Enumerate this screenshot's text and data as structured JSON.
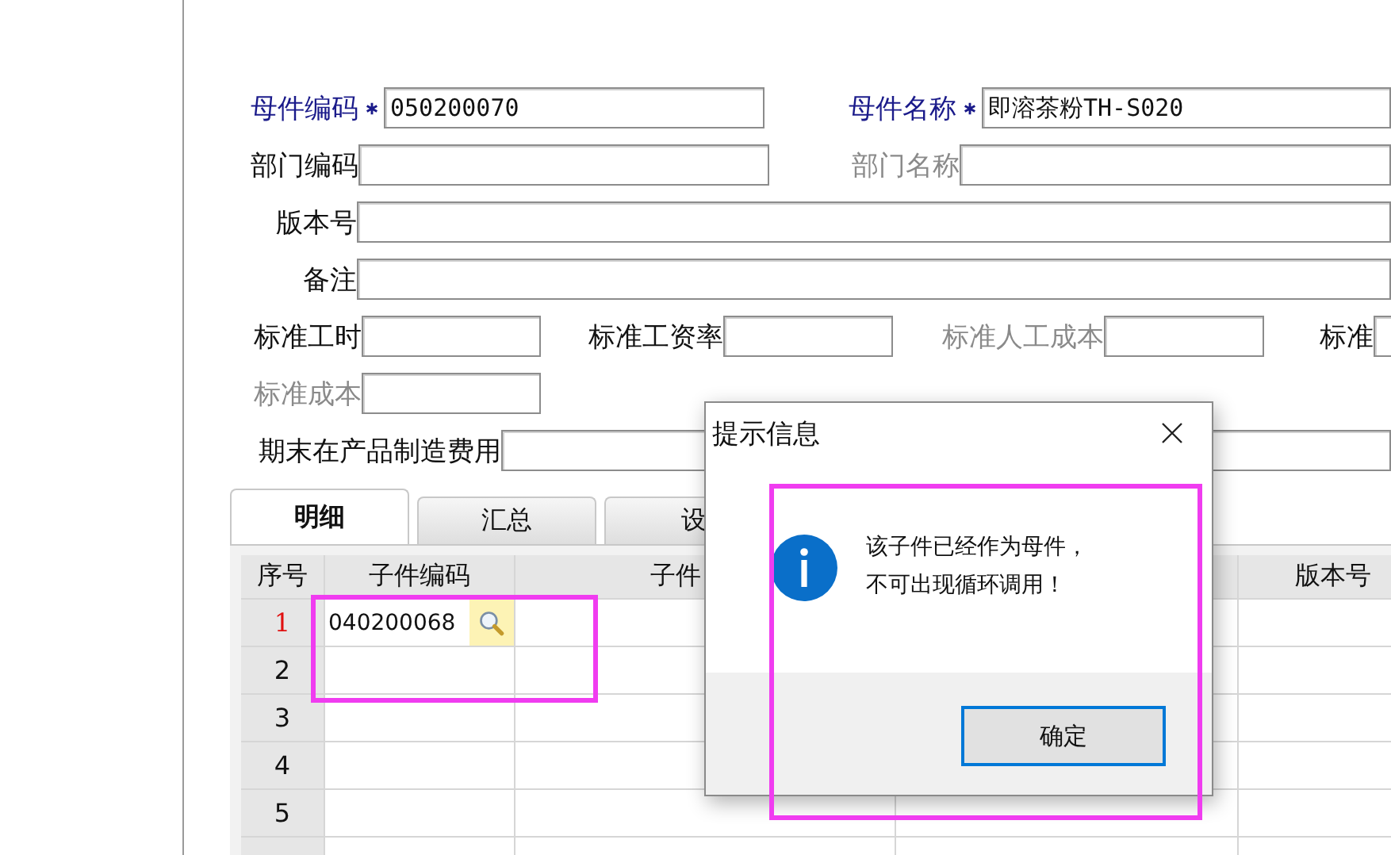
{
  "form": {
    "rows": [
      [
        {
          "label": "母件编码",
          "value": "050200070",
          "required": true,
          "disabled": false
        },
        {
          "label": "母件名称",
          "value": "即溶茶粉TH-S020",
          "required": true,
          "disabled": false
        }
      ],
      [
        {
          "label": "部门编码",
          "required": false,
          "disabled": false
        },
        {
          "label": "部门名称",
          "required": false,
          "disabled": true
        }
      ],
      [
        {
          "label": "版本号",
          "required": false,
          "disabled": false
        }
      ],
      [
        {
          "label": "备注",
          "required": false,
          "disabled": false
        }
      ],
      [
        {
          "label": "标准工时",
          "required": false,
          "disabled": false
        },
        {
          "label": "标准工资率",
          "required": false,
          "disabled": false
        },
        {
          "label": "标准人工成本",
          "required": false,
          "disabled": true
        },
        {
          "label": "标准",
          "required": false,
          "disabled": false
        }
      ],
      [
        {
          "label": "标准成本",
          "required": false,
          "disabled": true
        }
      ],
      [
        {
          "label": "期末在产品制造费用",
          "required": false,
          "disabled": false
        }
      ]
    ]
  },
  "tabs": [
    {
      "label": "明细",
      "selected": true
    },
    {
      "label": "汇总",
      "selected": false
    },
    {
      "label": "设",
      "selected": false
    }
  ],
  "table": {
    "columns": [
      "序号",
      "子件编码",
      "子件",
      "版本号"
    ],
    "rows": [
      {
        "number": "1",
        "flagged": true,
        "code": "040200068",
        "lookup": true
      },
      {
        "number": "2",
        "flagged": false,
        "lookup": false
      },
      {
        "number": "3",
        "flagged": false,
        "lookup": false
      },
      {
        "number": "4",
        "flagged": false,
        "lookup": false
      },
      {
        "number": "5",
        "flagged": false,
        "lookup": false
      }
    ]
  },
  "dialog": {
    "title": "提示信息",
    "message_lines": [
      "该子件已经作为母件，",
      "不可出现循环调用！"
    ],
    "button": "确定"
  }
}
